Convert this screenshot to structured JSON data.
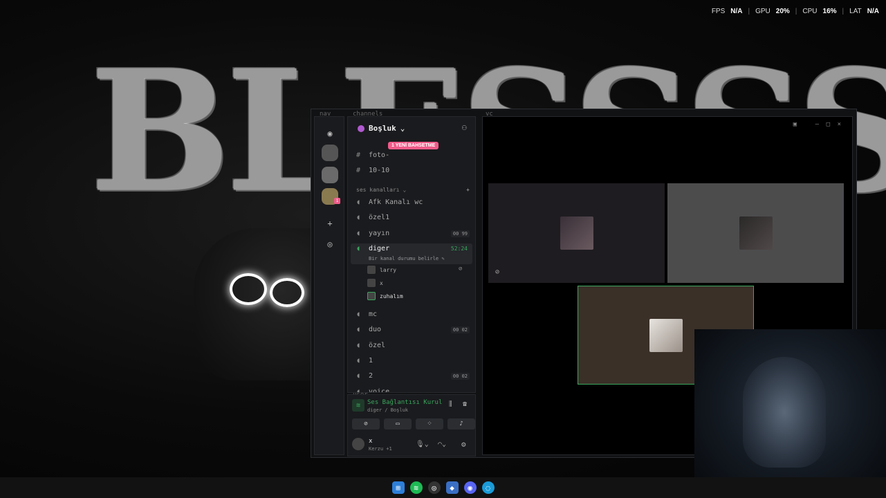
{
  "overlay": {
    "fps_label": "FPS",
    "fps_value": "N/A",
    "gpu_label": "GPU",
    "gpu_value": "20%",
    "cpu_label": "CPU",
    "cpu_value": "16%",
    "lat_label": "LAT",
    "lat_value": "N/A"
  },
  "wallpaper": {
    "title": "BLESSSSSS"
  },
  "sections": {
    "nav": "nav",
    "channels": "channels",
    "vc": "vc",
    "user": "user"
  },
  "server": {
    "name": "Boşluk"
  },
  "new_mentions_pill": "1 YENİ BAHSETME",
  "text_channels": [
    {
      "name": "foto-"
    },
    {
      "name": "10-10"
    }
  ],
  "voice_category": "ses kanalları",
  "voice_channels": [
    {
      "name": "Afk Kanalı wc",
      "count": ""
    },
    {
      "name": "özel1",
      "count": ""
    },
    {
      "name": "yayın",
      "count": "00 99"
    },
    {
      "name": "diger",
      "count": "52:24",
      "status": "Bir kanal durumu belirle"
    },
    {
      "name": "mc",
      "count": ""
    },
    {
      "name": "duo",
      "count": "00 02"
    },
    {
      "name": "özel",
      "count": ""
    },
    {
      "name": "1",
      "count": ""
    },
    {
      "name": "2",
      "count": "00 02"
    },
    {
      "name": "voice",
      "count": ""
    }
  ],
  "voice_members": [
    {
      "name": "larry"
    },
    {
      "name": "x"
    },
    {
      "name": "zuhalım"
    }
  ],
  "connection": {
    "title": "Ses Bağlantısı Kurul",
    "subtitle": "diger / Boşluk"
  },
  "current_user": {
    "name": "x",
    "activity": "Kerzu +1"
  },
  "nav_badge": "1"
}
